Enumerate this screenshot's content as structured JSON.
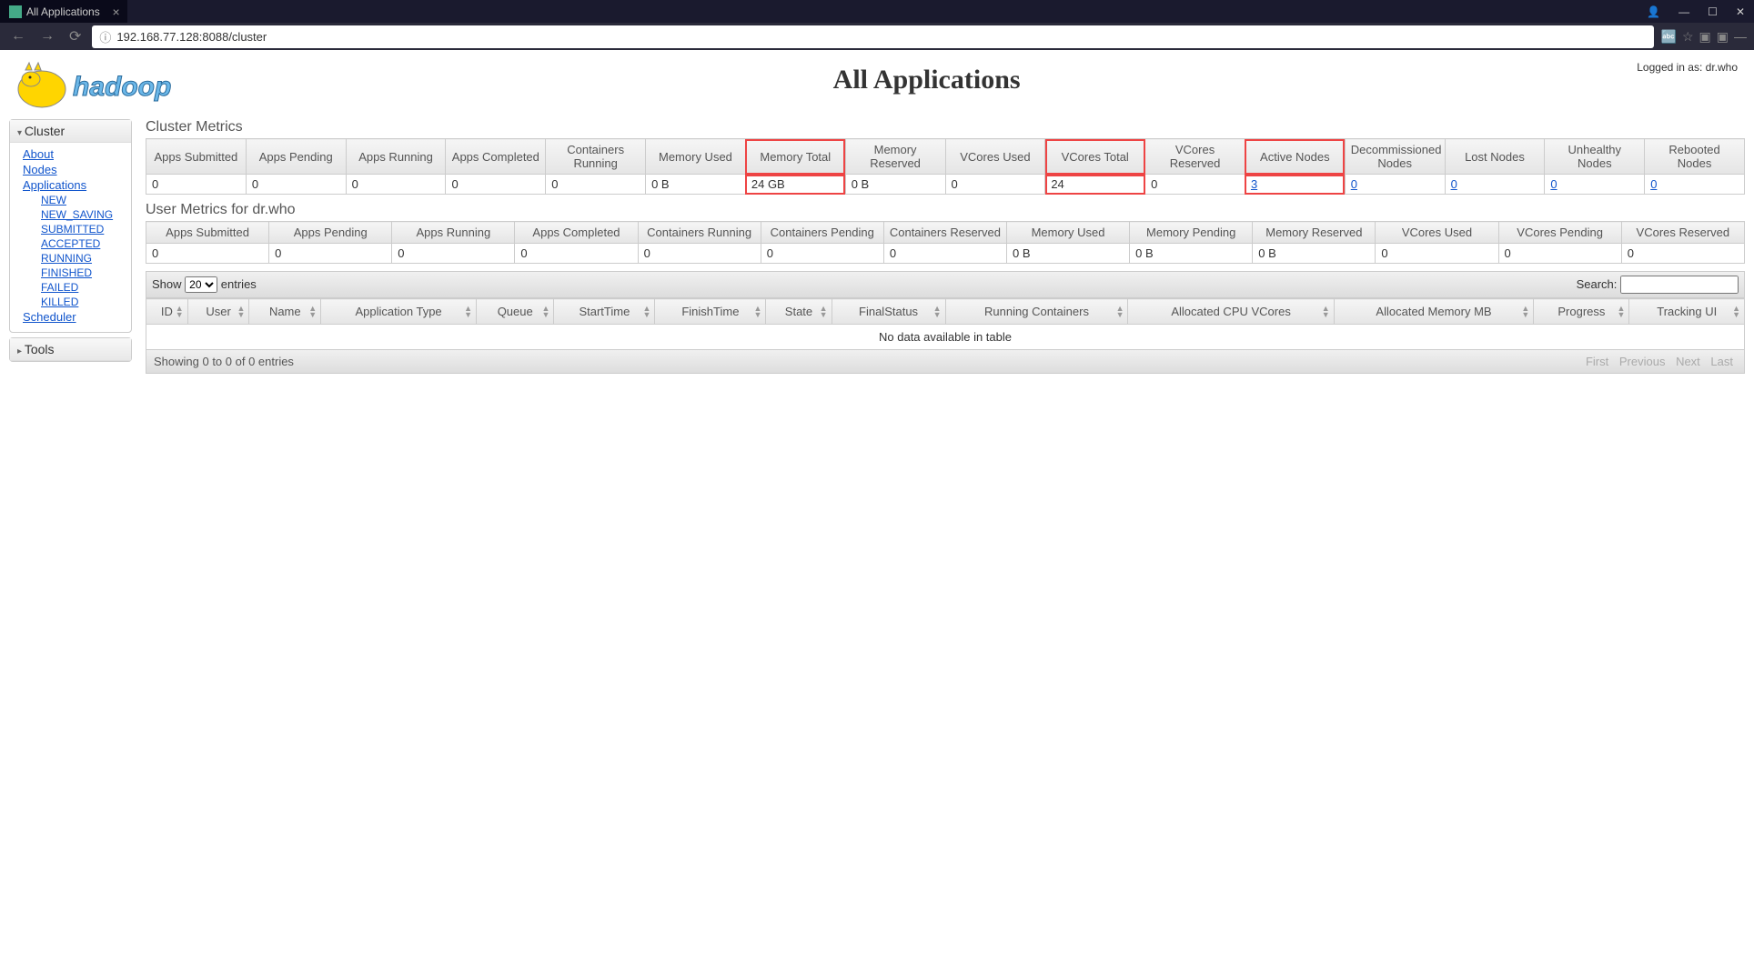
{
  "browser": {
    "tab_title": "All Applications",
    "url": "192.168.77.128:8088/cluster"
  },
  "page_title": "All Applications",
  "login_info": "Logged in as: dr.who",
  "sidebar": {
    "cluster": {
      "title": "Cluster",
      "about": "About",
      "nodes": "Nodes",
      "applications": "Applications",
      "app_states": [
        "NEW",
        "NEW_SAVING",
        "SUBMITTED",
        "ACCEPTED",
        "RUNNING",
        "FINISHED",
        "FAILED",
        "KILLED"
      ],
      "scheduler": "Scheduler"
    },
    "tools": {
      "title": "Tools"
    }
  },
  "cluster_metrics": {
    "title": "Cluster Metrics",
    "headers": [
      "Apps Submitted",
      "Apps Pending",
      "Apps Running",
      "Apps Completed",
      "Containers Running",
      "Memory Used",
      "Memory Total",
      "Memory Reserved",
      "VCores Used",
      "VCores Total",
      "VCores Reserved",
      "Active Nodes",
      "Decommissioned Nodes",
      "Lost Nodes",
      "Unhealthy Nodes",
      "Rebooted Nodes"
    ],
    "values": [
      "0",
      "0",
      "0",
      "0",
      "0",
      "0 B",
      "24 GB",
      "0 B",
      "0",
      "24",
      "0",
      "3",
      "0",
      "0",
      "0",
      "0"
    ]
  },
  "user_metrics": {
    "title": "User Metrics for dr.who",
    "headers": [
      "Apps Submitted",
      "Apps Pending",
      "Apps Running",
      "Apps Completed",
      "Containers Running",
      "Containers Pending",
      "Containers Reserved",
      "Memory Used",
      "Memory Pending",
      "Memory Reserved",
      "VCores Used",
      "VCores Pending",
      "VCores Reserved"
    ],
    "values": [
      "0",
      "0",
      "0",
      "0",
      "0",
      "0",
      "0",
      "0 B",
      "0 B",
      "0 B",
      "0",
      "0",
      "0"
    ]
  },
  "apps_table": {
    "show_label_pre": "Show",
    "show_label_post": "entries",
    "page_size": "20",
    "search_label": "Search:",
    "columns": [
      "ID",
      "User",
      "Name",
      "Application Type",
      "Queue",
      "StartTime",
      "FinishTime",
      "State",
      "FinalStatus",
      "Running Containers",
      "Allocated CPU VCores",
      "Allocated Memory MB",
      "Progress",
      "Tracking UI"
    ],
    "empty_message": "No data available in table",
    "info": "Showing 0 to 0 of 0 entries",
    "pager": [
      "First",
      "Previous",
      "Next",
      "Last"
    ]
  }
}
